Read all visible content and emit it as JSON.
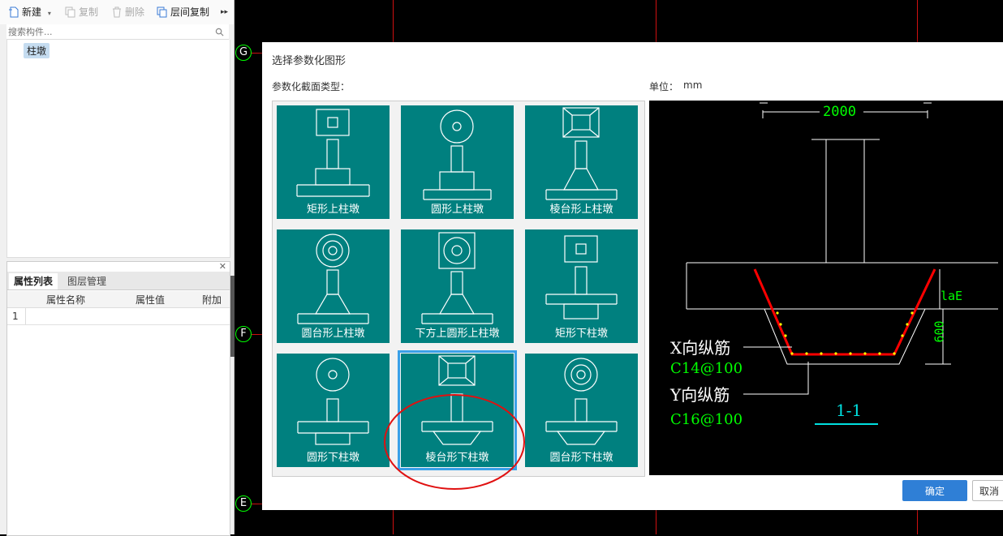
{
  "toolbar": {
    "new_label": "新建",
    "copy_label": "复制",
    "delete_label": "删除",
    "floor_copy_label": "层间复制",
    "more_label": "▸▸"
  },
  "search": {
    "placeholder": "搜索构件..."
  },
  "tree": {
    "selected_item": "柱墩"
  },
  "props": {
    "tab_attr": "属性列表",
    "tab_layer": "图层管理",
    "col_name": "属性名称",
    "col_value": "属性值",
    "col_extra": "附加",
    "row1": "1"
  },
  "axes": {
    "g": "G",
    "f": "F",
    "e": "E"
  },
  "dialog": {
    "title": "选择参数化图形",
    "section_label": "参数化截面类型：",
    "unit_label": "单位：",
    "unit_value": "mm",
    "ok_label": "确定",
    "cancel_label": "取消",
    "tiles": [
      "矩形上柱墩",
      "圆形上柱墩",
      "棱台形上柱墩",
      "圆台形上柱墩",
      "下方上圆形上柱墩",
      "矩形下柱墩",
      "圆形下柱墩",
      "棱台形下柱墩",
      "圆台形下柱墩"
    ],
    "selected_tile": "棱台形下柱墩"
  },
  "preview": {
    "dim_top": "2000",
    "dim_lae": "laE",
    "dim_depth": "600",
    "x_rebar_label": "X向纵筋",
    "x_rebar_value": "C14@100",
    "y_rebar_label": "Y向纵筋",
    "y_rebar_value": "C16@100",
    "section_mark": "1-1"
  },
  "colors": {
    "teal": "#00807f",
    "select": "#3aa0e8",
    "primary": "#2f7fd6",
    "grid": "#d01010",
    "axis": "#00ff00",
    "rebar": "#ff0000",
    "annotation_green": "#00ff00",
    "section_cyan": "#00e0e0"
  }
}
